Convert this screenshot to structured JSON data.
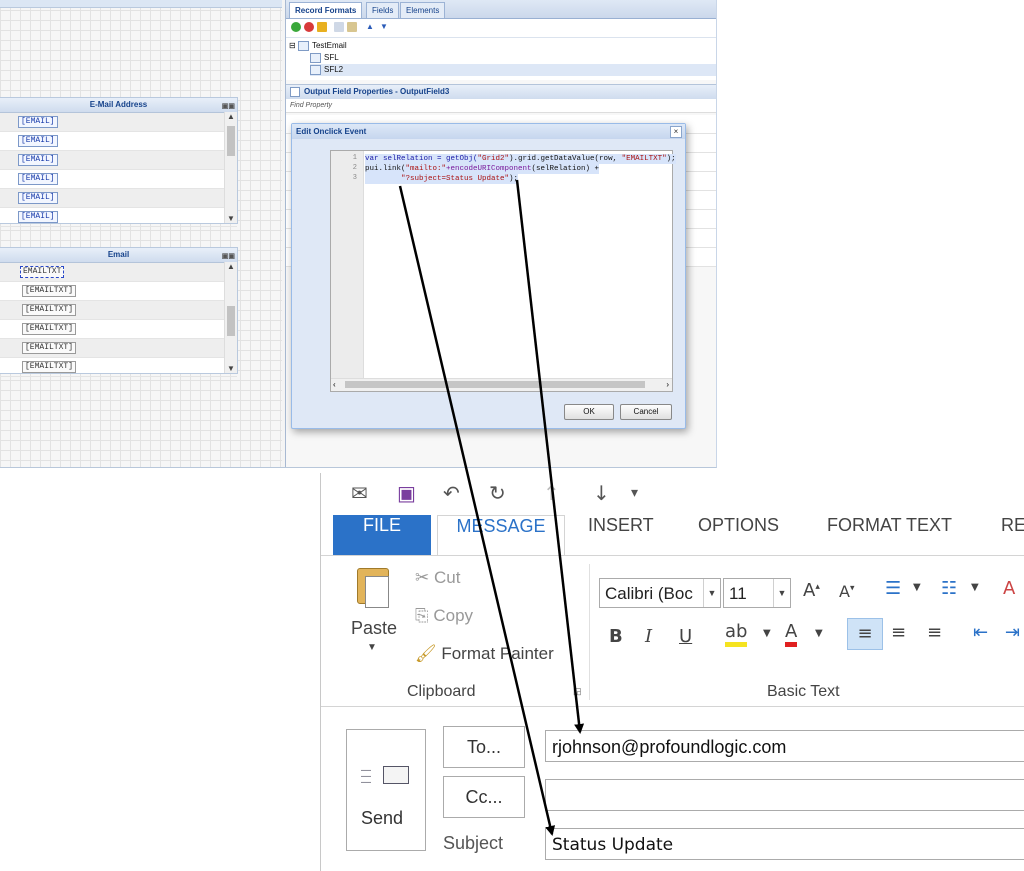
{
  "designer": {
    "grid1": {
      "header": "E-Mail Address",
      "rows": [
        "[EMAIL]",
        "[EMAIL]",
        "[EMAIL]",
        "[EMAIL]",
        "[EMAIL]",
        "[EMAIL]"
      ]
    },
    "grid2": {
      "header": "Email",
      "rows": [
        "EMAILTXT",
        "[EMAILTXT]",
        "[EMAILTXT]",
        "[EMAILTXT]",
        "[EMAILTXT]",
        "[EMAILTXT]"
      ]
    }
  },
  "right_panel": {
    "tabs": [
      "Record Formats",
      "Fields",
      "Elements"
    ],
    "tree": {
      "root": "TestEmail",
      "children": [
        "SFL",
        "SFL2"
      ]
    },
    "properties_title": "Output Field Properties - OutputField3",
    "find_property": "Find Property"
  },
  "dialog": {
    "title": "Edit Onclick Event",
    "line_numbers": [
      "1",
      "2",
      "3"
    ],
    "code": {
      "l1_a": "var selRelation = getObj(",
      "l1_b": "\"Grid2\"",
      "l1_c": ").grid.getDataValue(row, ",
      "l1_d": "\"EMAILTXT\"",
      "l1_e": ");",
      "l2_a": "pui.link(",
      "l2_b": "\"mailto:\"",
      "l2_c": "+encodeURIComponent",
      "l2_d": "(selRelation) +",
      "l3_a": "        ",
      "l3_b": "\"?subject=Status Update\"",
      "l3_c": ");"
    },
    "ok_label": "OK",
    "cancel_label": "Cancel"
  },
  "outlook": {
    "ribbon_tabs": [
      "FILE",
      "MESSAGE",
      "INSERT",
      "OPTIONS",
      "FORMAT TEXT",
      "REV"
    ],
    "clipboard": {
      "paste": "Paste",
      "cut": "Cut",
      "copy": "Copy",
      "format_painter": "Format Painter",
      "group_label": "Clipboard"
    },
    "basic_text": {
      "font": "Calibri (Boc",
      "size": "11",
      "group_label": "Basic Text"
    },
    "send_label": "Send",
    "to_label": "To...",
    "cc_label": "Cc...",
    "subject_label": "Subject",
    "to_value": "rjohnson@profoundlogic.com",
    "cc_value": "",
    "subject_value": "Status Update"
  },
  "colors": {
    "file_tab": "#2b72c8",
    "designer_header": "#15428b"
  }
}
